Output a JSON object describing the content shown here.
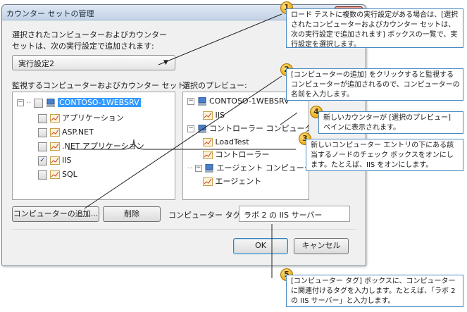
{
  "dialog": {
    "title": "カウンター セットの管理",
    "close_glyph": "✕",
    "intro_line1": "選択されたコンピューターおよびカウンター",
    "intro_line2": "セットは、次の実行設定で追加されます:",
    "run_setting": "実行設定2",
    "monitor_label": "監視するコンピューターおよびカウンター セット:",
    "preview_label": "選択のプレビュー:",
    "tree": {
      "computer": "CONTOSO-1WEBSRV",
      "counters": [
        {
          "label": "アプリケーション",
          "checked": false
        },
        {
          "label": "ASP.NET",
          "checked": false
        },
        {
          "label": ".NET アプリケーション",
          "checked": false
        },
        {
          "label": "IIS",
          "checked": true
        },
        {
          "label": "SQL",
          "checked": false
        }
      ]
    },
    "preview": {
      "computer": "CONTOSO-1WEBSRV",
      "computer_child": "IIS",
      "controller": "コントローラー コンピューター",
      "controller_children": [
        "LoadTest",
        "コントローラー"
      ],
      "agent": "エージェント コンピューター",
      "agent_child": "エージェント"
    },
    "add_button": "コンピューターの追加...",
    "delete_button": "削除",
    "tag_label": "コンピューター タグ:",
    "tag_value": "ラボ 2 の IIS サーバー",
    "ok_button": "OK",
    "cancel_button": "キャンセル"
  },
  "callouts": [
    {
      "num": "1",
      "text": "ロード テストに複数の実行設定がある場合は、[選択されたコンピューターおよびカウンター セットは、次の実行設定で追加されます] ボックスの一覧で、実行設定を選択します。"
    },
    {
      "num": "2",
      "text": "[コンピューターの追加] をクリックすると監視するコンピューターが追加されるので、コンピューターの名前を入力します。"
    },
    {
      "num": "3",
      "text": "新しいコンピューター エントリの下にある該当するノードのチェック ボックスをオンにします。たとえば、IIS をオンにします。"
    },
    {
      "num": "4",
      "text": "新しいカウンターが [選択のプレビュー] ペインに表示されます。"
    },
    {
      "num": "5",
      "text": "[コンピューター タグ] ボックスに、コンピューターに関連付けるタグを入力します。たとえば、「ラボ 2 の IIS サーバー」と入力します。"
    }
  ]
}
